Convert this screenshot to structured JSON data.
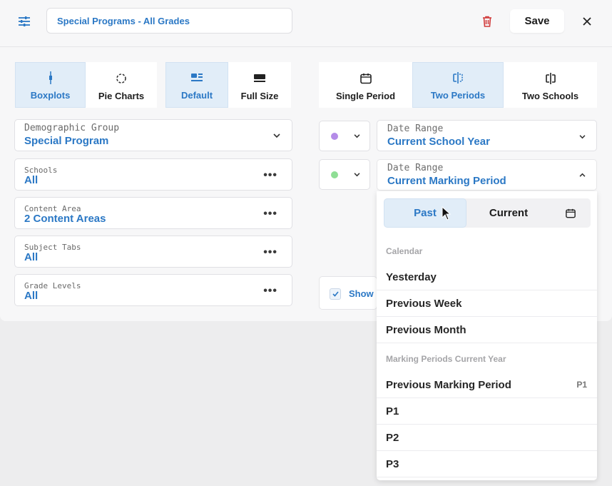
{
  "header": {
    "filter_icon": "sliders-icon",
    "title_value": "Special Programs - All Grades",
    "delete_icon": "trash-icon",
    "save_label": "Save",
    "close_icon": "close-icon"
  },
  "chart_type": {
    "boxplots": "Boxplots",
    "pie_charts": "Pie Charts",
    "selected": "Boxplots"
  },
  "size_mode": {
    "default": "Default",
    "full_size": "Full Size",
    "selected": "Default"
  },
  "comparison": {
    "single_period": "Single Period",
    "two_periods": "Two Periods",
    "two_schools": "Two Schools",
    "selected": "Two Periods"
  },
  "filters": {
    "demographic": {
      "label": "Demographic Group",
      "value": "Special Program"
    },
    "schools": {
      "label": "Schools",
      "value": "All"
    },
    "content_area": {
      "label": "Content Area",
      "value": "2 Content Areas"
    },
    "subject_tabs": {
      "label": "Subject Tabs",
      "value": "All"
    },
    "grade_levels": {
      "label": "Grade Levels",
      "value": "All"
    }
  },
  "periods": {
    "first": {
      "color": "#b48ce8",
      "label": "Date Range",
      "value": "Current School Year"
    },
    "second": {
      "color": "#8fde95",
      "label": "Date Range",
      "value": "Current Marking Period"
    }
  },
  "show_option": {
    "label": "Show",
    "checked": true
  },
  "date_menu": {
    "tabs": [
      "Past",
      "Current"
    ],
    "selected_tab": "Past",
    "calendar_icon": "calendar-icon",
    "section_calendar": "Calendar",
    "calendar_items": [
      "Yesterday",
      "Previous Week",
      "Previous Month"
    ],
    "section_marking": "Marking Periods Current Year",
    "marking_items": [
      {
        "label": "Previous Marking Period",
        "tag": "P1"
      },
      {
        "label": "P1",
        "tag": ""
      },
      {
        "label": "P2",
        "tag": ""
      },
      {
        "label": "P3",
        "tag": ""
      }
    ]
  },
  "colors": {
    "accent": "#2b78c5",
    "active_bg": "#e1edf8",
    "delete": "#d13b3b"
  }
}
